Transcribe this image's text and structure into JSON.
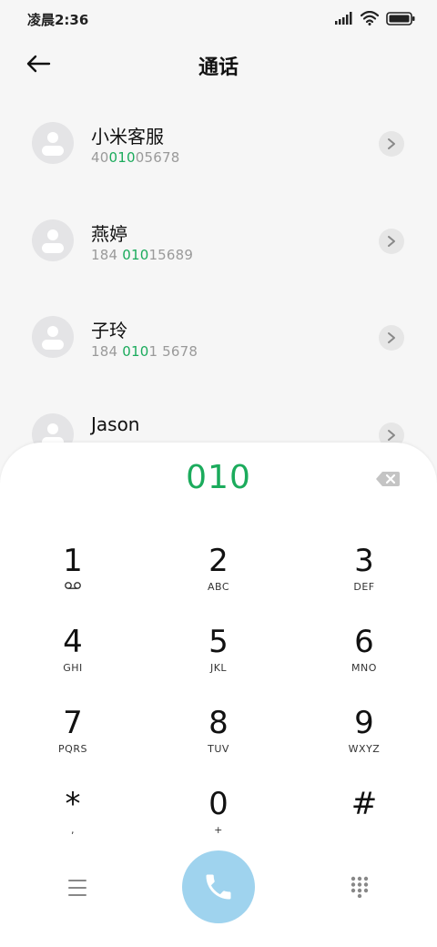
{
  "status_bar": {
    "time": "凌晨2:36"
  },
  "header": {
    "title": "通话"
  },
  "contacts": [
    {
      "name": "小米客服",
      "number_before": "40",
      "number_match": "010",
      "number_after": "05678"
    },
    {
      "name": "燕婷",
      "number_before": "184 ",
      "number_match": "010",
      "number_after": "15689"
    },
    {
      "name": "子玲",
      "number_before": "184 ",
      "number_match": "010",
      "number_after": "1 5678"
    },
    {
      "name": "Jason",
      "number_before": "",
      "number_match": "",
      "number_after": ""
    }
  ],
  "dialpad": {
    "input": "010",
    "keys": [
      {
        "digit": "1",
        "letters": ""
      },
      {
        "digit": "2",
        "letters": "ABC"
      },
      {
        "digit": "3",
        "letters": "DEF"
      },
      {
        "digit": "4",
        "letters": "GHI"
      },
      {
        "digit": "5",
        "letters": "JKL"
      },
      {
        "digit": "6",
        "letters": "MNO"
      },
      {
        "digit": "7",
        "letters": "PQRS"
      },
      {
        "digit": "8",
        "letters": "TUV"
      },
      {
        "digit": "9",
        "letters": "WXYZ"
      },
      {
        "digit": "*",
        "letters": ","
      },
      {
        "digit": "0",
        "letters": "+"
      },
      {
        "digit": "#",
        "letters": ""
      }
    ]
  },
  "icons": {
    "back": "back-arrow-icon",
    "voicemail": "voicemail-icon",
    "backspace": "backspace-icon",
    "menu": "menu-icon",
    "call": "phone-icon",
    "keypad": "keypad-icon",
    "signal": "signal-icon",
    "wifi": "wifi-icon",
    "battery": "battery-icon"
  },
  "colors": {
    "accent": "#1bab5c",
    "call_button": "#9fd3ee",
    "background": "#f6f6f6"
  }
}
